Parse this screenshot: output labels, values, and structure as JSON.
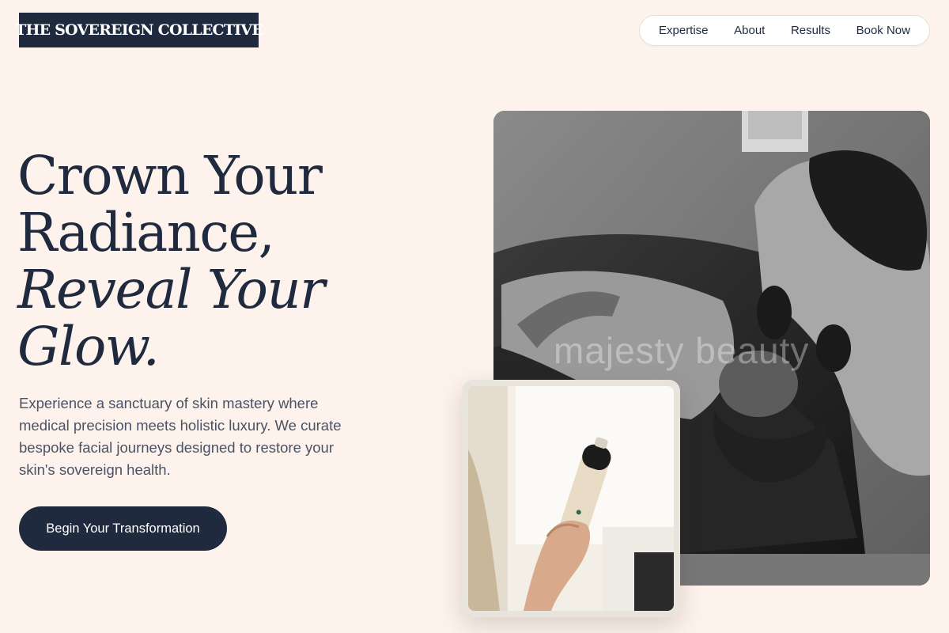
{
  "header": {
    "logo_text": "THE SOVEREIGN COLLECTIVE",
    "nav": [
      {
        "label": "Expertise"
      },
      {
        "label": "About"
      },
      {
        "label": "Results"
      },
      {
        "label": "Book Now"
      }
    ]
  },
  "hero": {
    "headline_line1": "Crown Your",
    "headline_line2": "Radiance,",
    "headline_line3": "Reveal Your",
    "headline_line4": "Glow.",
    "lead": "Experience a sanctuary of skin mastery where medical precision meets holistic luxury. We curate bespoke facial journeys designed to restore your skin's sovereign health.",
    "cta_label": "Begin Your Transformation"
  },
  "media": {
    "main_watermark": "majesty beauty"
  },
  "colors": {
    "background": "#fdf3ec",
    "navy": "#1f2a3f",
    "body_text": "#4a5263"
  }
}
